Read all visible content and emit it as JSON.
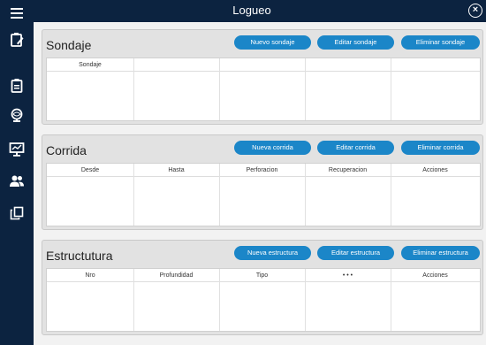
{
  "window": {
    "title": "Logueo",
    "close_icon": "close-circle-icon"
  },
  "sidebar": {
    "icons": [
      "menu-icon",
      "clipboard-pen-icon",
      "clipboard-list-icon",
      "globe-icon",
      "monitor-chart-icon",
      "users-icon",
      "copy-icon"
    ]
  },
  "sondaje": {
    "title": "Sondaje",
    "buttons": {
      "new": "Nuevo sondaje",
      "edit": "Editar sondaje",
      "delete": "Eliminar sondaje"
    },
    "columns": [
      "Sondaje",
      "",
      "",
      "",
      ""
    ]
  },
  "corrida": {
    "title": "Corrida",
    "buttons": {
      "new": "Nueva corrida",
      "edit": "Editar corrida",
      "delete": "Eliminar corrida"
    },
    "columns": [
      "Desde",
      "Hasta",
      "Perforacion",
      "Recuperacion",
      "Acciones"
    ]
  },
  "estructura": {
    "title": "Estructutura",
    "buttons": {
      "new": "Nueva estructura",
      "edit": "Editar estructura",
      "delete": "Eliminar estructura"
    },
    "columns": [
      "Nro",
      "Profundidad",
      "Tipo",
      "• • •",
      "Acciones"
    ]
  },
  "colors": {
    "accent": "#1b86c8",
    "sidebar": "#0c2340",
    "panel": "#e2e2e2"
  }
}
